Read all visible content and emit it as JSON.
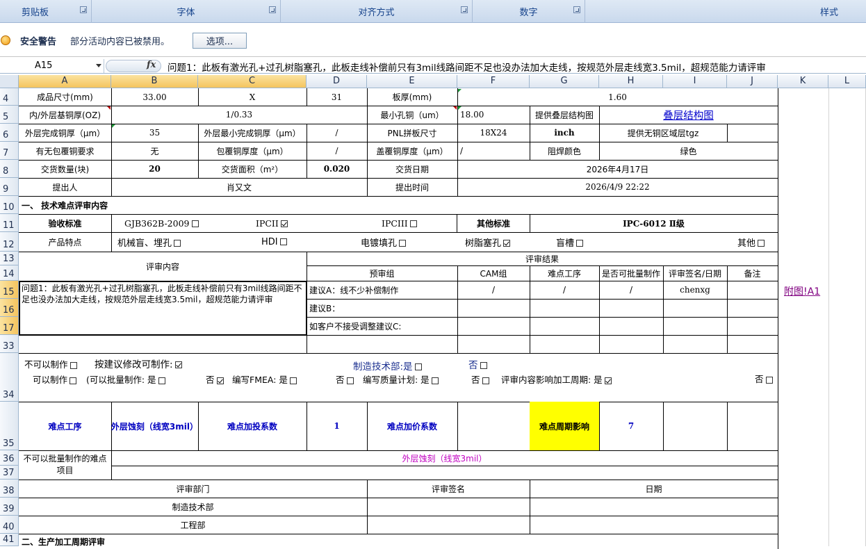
{
  "ribbon": {
    "clipboard": "剪贴板",
    "font": "字体",
    "alignment": "对齐方式",
    "number": "数字",
    "styles": "样式"
  },
  "security": {
    "title": "安全警告",
    "message": "部分活动内容已被禁用。",
    "options_button": "选项..."
  },
  "formula_bar": {
    "cell_ref": "A15",
    "fx": "fx",
    "content": "问题1：此板有激光孔+过孔树脂塞孔，此板走线补偿前只有3mil线路间距不足也没办法加大走线，按规范外层走线宽3.5mil，超规范能力请评审"
  },
  "columns": [
    "A",
    "B",
    "C",
    "D",
    "E",
    "F",
    "G",
    "H",
    "I",
    "J",
    "K",
    "L"
  ],
  "rows": [
    "4",
    "5",
    "6",
    "7",
    "8",
    "9",
    "10",
    "11",
    "12",
    "13",
    "14",
    "15",
    "16",
    "17",
    "33",
    "34",
    "35",
    "36",
    "37",
    "38",
    "39",
    "40",
    "41"
  ],
  "sheet": {
    "r4": {
      "a": "成品尺寸(mm)",
      "b": "33.00",
      "c": "X",
      "d": "31",
      "e": "板厚(mm)",
      "fh": "1.60"
    },
    "r5": {
      "a": "内/外层基铜厚(OZ)",
      "bd": "1/0.33",
      "e": "最小孔铜（um）",
      "f": "18.00",
      "g": "提供叠层结构图",
      "h": "叠层结构图"
    },
    "r6": {
      "a": "外层完成铜厚（μm）",
      "b": "35",
      "c": "外层最小完成铜厚（μm）",
      "d": "/",
      "e": "PNL拼板尺寸",
      "f": "18X24",
      "g": "inch",
      "h": "提供无铜区域层tgz"
    },
    "r7": {
      "a": "有无包覆铜要求",
      "b": "无",
      "c": "包覆铜厚度（μm）",
      "d": "/",
      "e": "盖覆铜厚度（μm）",
      "f": "/",
      "g": "阻焊颜色",
      "h": "绿色"
    },
    "r8": {
      "a": "交货数量(块)",
      "b": "20",
      "c": "交货面积（m²）",
      "d": "0.020",
      "e": "交货日期",
      "fh": "2026年4月17日"
    },
    "r9": {
      "a": "提出人",
      "bd": "肖又文",
      "e": "提出时间",
      "fh": "2026/4/9 22:22"
    },
    "r10": {
      "a": "一、 技术难点评审内容"
    },
    "r11": {
      "a": "验收标准",
      "b": "GJB362B-2009",
      "c": "IPCII",
      "e": "IPCIII",
      "f": "其他标准",
      "gh": "IPC-6012 Ⅱ级"
    },
    "r12": {
      "a": "产品特点",
      "items": [
        "机械盲、埋孔",
        "HDI",
        "电镀填孔",
        "树脂塞孔",
        "盲槽",
        "其他"
      ]
    },
    "r13": {
      "a": "评审内容",
      "result": "评审结果"
    },
    "r14": {
      "e": "预审组",
      "f": "CAM组",
      "g": "难点工序",
      "h": "是否可批量制作",
      "i": "评审签名/日期",
      "j": "备注"
    },
    "r15": {
      "a": "问题1：此板有激光孔+过孔树脂塞孔，此板走线补偿前只有3mil线路间距不足也没办法加大走线，按规范外层走线宽3.5mil，超规范能力请评审",
      "d": "建议A：线不少补偿制作",
      "f": "/",
      "g": "/",
      "h": "/",
      "i": "chenxg",
      "k": "附图!A1"
    },
    "r16": {
      "d": "建议B："
    },
    "r17": {
      "d": "如客户不接受调整建议C:"
    },
    "r34": {
      "cannot": "不可以制作",
      "suggest": "按建议修改可制作:",
      "mfg_dept": "制造技术部:是",
      "no1": "否",
      "can": "可以制作",
      "batch": "(可以批量制作: 是",
      "no2": "否",
      "fmea": "编写FMEA: 是",
      "no3": "否",
      "quality": "编写质量计划: 是",
      "no4": "否",
      "cycle": "评审内容影响加工周期: 是",
      "no5": "否"
    },
    "r35": {
      "a": "难点工序",
      "b": "外层蚀刻（线宽3mil）",
      "c": "难点加投系数",
      "d": "1",
      "e": "难点加价系数",
      "g": "难点周期影响",
      "h": "7"
    },
    "r36": {
      "a": "不可以批量制作的难点项目",
      "b": "外层蚀刻（线宽3mil）"
    },
    "r38": {
      "a": "评审部门",
      "e": "评审签名",
      "g": "日期"
    },
    "r39": {
      "a": "制造技术部"
    },
    "r40": {
      "a": "工程部"
    },
    "r41": {
      "a": "二、生产加工周期评审"
    }
  },
  "colors": {
    "yellow": "#ffff00",
    "blue_text": "#0000c0",
    "magenta_text": "#c000c0",
    "selection": "#f4c45e"
  }
}
